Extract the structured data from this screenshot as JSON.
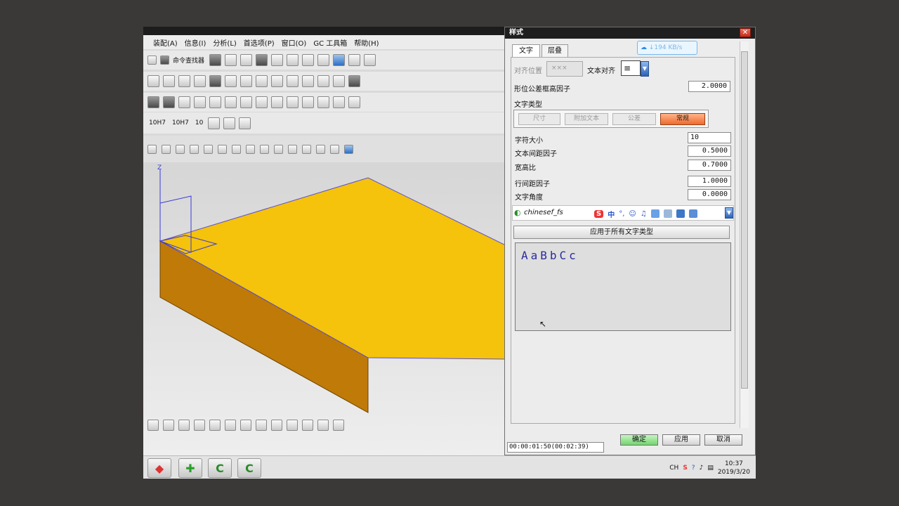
{
  "menubar": {
    "items": [
      "装配(A)",
      "信息(I)",
      "分析(L)",
      "首选项(P)",
      "窗口(O)",
      "GC 工具箱",
      "帮助(H)"
    ]
  },
  "toolbar": {
    "command_finder": "命令查找器"
  },
  "snap_labels": [
    "10H7",
    "10H7",
    "10"
  ],
  "dialog": {
    "title": "样式",
    "close": "✕",
    "tabs": [
      "文字",
      "层叠"
    ],
    "net_speed": "↓194 KB/s",
    "align_pos_label": "对齐位置",
    "text_align_label": "文本对齐",
    "tol_height_label": "形位公差框高因子",
    "tol_height_value": "2.0000",
    "text_type_label": "文字类型",
    "text_types": [
      "尺寸",
      "附加文本",
      "公差",
      "常规"
    ],
    "char_size_label": "字符大小",
    "char_size_value": "10",
    "char_gap_label": "文本间距因子",
    "char_gap_value": "0.5000",
    "aspect_label": "宽高比",
    "aspect_value": "0.7000",
    "line_gap_label": "行间距因子",
    "line_gap_value": "1.0000",
    "angle_label": "文字角度",
    "angle_value": "0.0000",
    "font_name": "chinesef_fs",
    "ime_chinese": "中",
    "apply_all": "应用于所有文字类型",
    "preview_text": "AaBbCc",
    "ok": "确定",
    "apply": "应用",
    "cancel": "取消"
  },
  "timer": "00:00:01:50(00:02:39)",
  "taskbar": {
    "lang": "CH",
    "time": "10:37",
    "date": "2019/3/20"
  },
  "colors": {
    "part_top": "#f5c20c",
    "part_side": "#c07a08",
    "preview_text": "#2a2aa0",
    "active_type_button": "#f06a2e",
    "ok_button": "#74d36e"
  }
}
